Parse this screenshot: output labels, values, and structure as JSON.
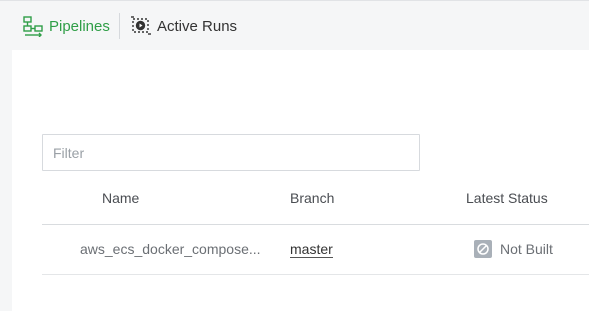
{
  "nav": {
    "tabs": [
      {
        "label": "Pipelines",
        "icon": "pipelines-icon",
        "active": true,
        "color": "#2f9e47"
      },
      {
        "label": "Active Runs",
        "icon": "active-runs-icon",
        "active": false
      }
    ]
  },
  "filter": {
    "placeholder": "Filter",
    "value": ""
  },
  "table": {
    "columns": [
      "Name",
      "Branch",
      "Latest Status"
    ],
    "rows": [
      {
        "name": "aws_ecs_docker_compose...",
        "branch": "master",
        "status": "Not Built",
        "status_icon": "not-built-icon"
      }
    ]
  }
}
